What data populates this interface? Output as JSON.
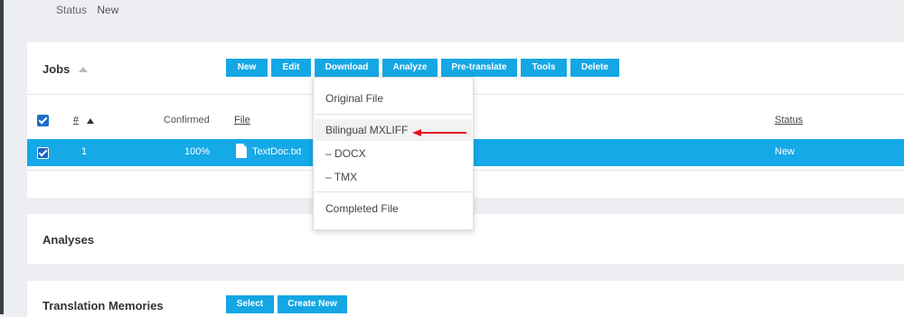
{
  "top_status": {
    "label": "Status",
    "value": "New"
  },
  "jobs": {
    "title": "Jobs",
    "buttons": [
      "New",
      "Edit",
      "Download",
      "Analyze",
      "Pre-translate",
      "Tools",
      "Delete"
    ],
    "columns": {
      "num": "#",
      "confirmed": "Confirmed",
      "file": "File",
      "status": "Status"
    },
    "rows": [
      {
        "num": "1",
        "confirmed": "100%",
        "file": "TextDoc.txt",
        "status": "New",
        "checked": true
      }
    ]
  },
  "download_menu": {
    "items": [
      "Original File",
      "Bilingual MXLIFF",
      "– DOCX",
      "– TMX",
      "Completed File"
    ],
    "highlighted": "Bilingual MXLIFF"
  },
  "analyses": {
    "title": "Analyses"
  },
  "translation_memories": {
    "title": "Translation Memories",
    "buttons": [
      "Select",
      "Create New"
    ]
  },
  "colors": {
    "accent": "#14a7e4",
    "row_selected": "#15a9e8",
    "annotation_arrow": "#e3101d"
  }
}
